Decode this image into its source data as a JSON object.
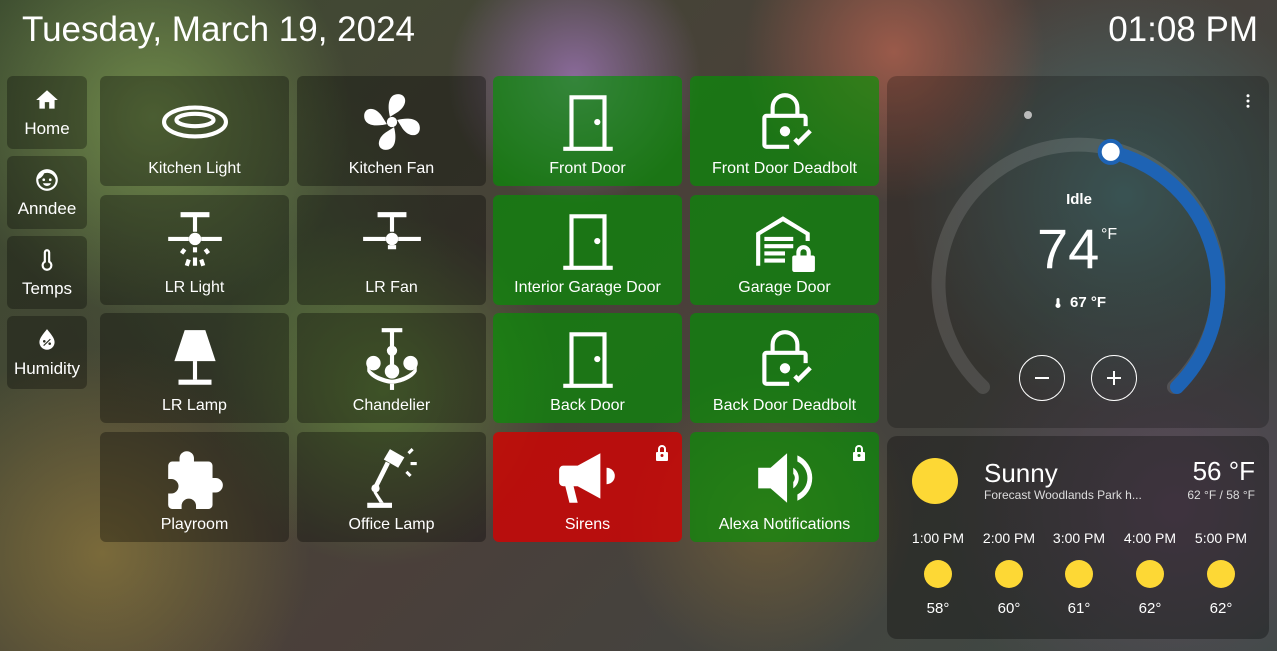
{
  "header": {
    "date": "Tuesday, March 19, 2024",
    "time": "01:08 PM"
  },
  "nav": [
    {
      "label": "Home",
      "icon": "home-icon"
    },
    {
      "label": "Anndee",
      "icon": "face-icon"
    },
    {
      "label": "Temps",
      "icon": "thermometer-icon"
    },
    {
      "label": "Humidity",
      "icon": "humidity-icon"
    }
  ],
  "tiles": [
    {
      "label": "Kitchen Light",
      "icon": "ceiling-light-icon",
      "state": "off"
    },
    {
      "label": "Kitchen Fan",
      "icon": "fan-icon",
      "state": "off"
    },
    {
      "label": "Front Door",
      "icon": "door-icon",
      "state": "on"
    },
    {
      "label": "Front Door Deadbolt",
      "icon": "lock-check-icon",
      "state": "on"
    },
    {
      "label": "LR Light",
      "icon": "ceiling-fan-light-icon",
      "state": "off"
    },
    {
      "label": "LR Fan",
      "icon": "ceiling-fan-icon",
      "state": "off"
    },
    {
      "label": "Interior Garage Door",
      "icon": "door-icon",
      "state": "on"
    },
    {
      "label": "Garage Door",
      "icon": "garage-lock-icon",
      "state": "on"
    },
    {
      "label": "LR Lamp",
      "icon": "lamp-icon",
      "state": "off"
    },
    {
      "label": "Chandelier",
      "icon": "chandelier-icon",
      "state": "off"
    },
    {
      "label": "Back Door",
      "icon": "door-icon",
      "state": "on"
    },
    {
      "label": "Back Door Deadbolt",
      "icon": "lock-check-icon",
      "state": "on"
    },
    {
      "label": "Playroom",
      "icon": "puzzle-icon",
      "state": "off"
    },
    {
      "label": "Office Lamp",
      "icon": "desk-lamp-icon",
      "state": "off"
    },
    {
      "label": "Sirens",
      "icon": "bullhorn-icon",
      "state": "alert"
    },
    {
      "label": "Alexa Notifications",
      "icon": "volume-icon",
      "state": "on"
    }
  ],
  "thermostat": {
    "state": "Idle",
    "target": "74",
    "unit": "°F",
    "current": "67 °F",
    "setpoint_fraction": 0.55
  },
  "weather": {
    "condition": "Sunny",
    "subtitle": "Forecast Woodlands Park h...",
    "temp": "56 °F",
    "hilo": "62 °F / 58 °F",
    "forecast": [
      {
        "time": "1:00 PM",
        "temp": "58°"
      },
      {
        "time": "2:00 PM",
        "temp": "60°"
      },
      {
        "time": "3:00 PM",
        "temp": "61°"
      },
      {
        "time": "4:00 PM",
        "temp": "62°"
      },
      {
        "time": "5:00 PM",
        "temp": "62°"
      }
    ]
  },
  "colors": {
    "on": "#0a960a",
    "alert": "#d70000",
    "arc": "#1e63b4",
    "sun": "#fdd835"
  }
}
